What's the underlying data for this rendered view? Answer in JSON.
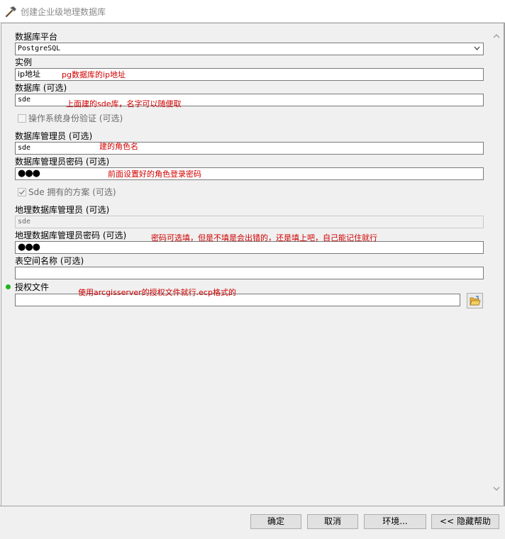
{
  "window": {
    "title": "创建企业级地理数据库",
    "icon": "hammer-icon"
  },
  "form": {
    "platform_label": "数据库平台",
    "platform_value": "PostgreSQL",
    "instance_label": "实例",
    "instance_value": "ip地址",
    "database_label": "数据库 (可选)",
    "database_value": "sde",
    "os_auth_label": "操作系统身份验证 (可选)",
    "os_auth_checked": false,
    "dba_label": "数据库管理员 (可选)",
    "dba_value": "sde",
    "dba_password_label": "数据库管理员密码 (可选)",
    "dba_password_value": "●●●",
    "sde_schema_label": "Sde 拥有的方案 (可选)",
    "sde_schema_checked": true,
    "gdb_admin_label": "地理数据库管理员 (可选)",
    "gdb_admin_value": "sde",
    "gdb_admin_password_label": "地理数据库管理员密码 (可选)",
    "gdb_admin_password_value": "●●●",
    "tablespace_label": "表空间名称 (可选)",
    "tablespace_value": "",
    "auth_file_label": "授权文件",
    "auth_file_value": ""
  },
  "annotations": {
    "instance_note": "pg数据库的ip地址",
    "database_note": "上面建的sde库，名字可以随便取",
    "dba_note": "建的角色名",
    "dba_password_note": "前面设置好的角色登录密码",
    "gdb_password_note": "密码可选填，但是不填是会出错的，还是填上吧，自己能记住就行",
    "auth_file_note": "使用arcgisserver的授权文件就行.ecp格式的"
  },
  "buttons": {
    "ok": "确定",
    "cancel": "取消",
    "environments": "环境...",
    "hide_help": "<< 隐藏帮助"
  },
  "colors": {
    "note": "#d00000",
    "required_dot": "#1fb41f",
    "panel": "#f0f0f0"
  }
}
